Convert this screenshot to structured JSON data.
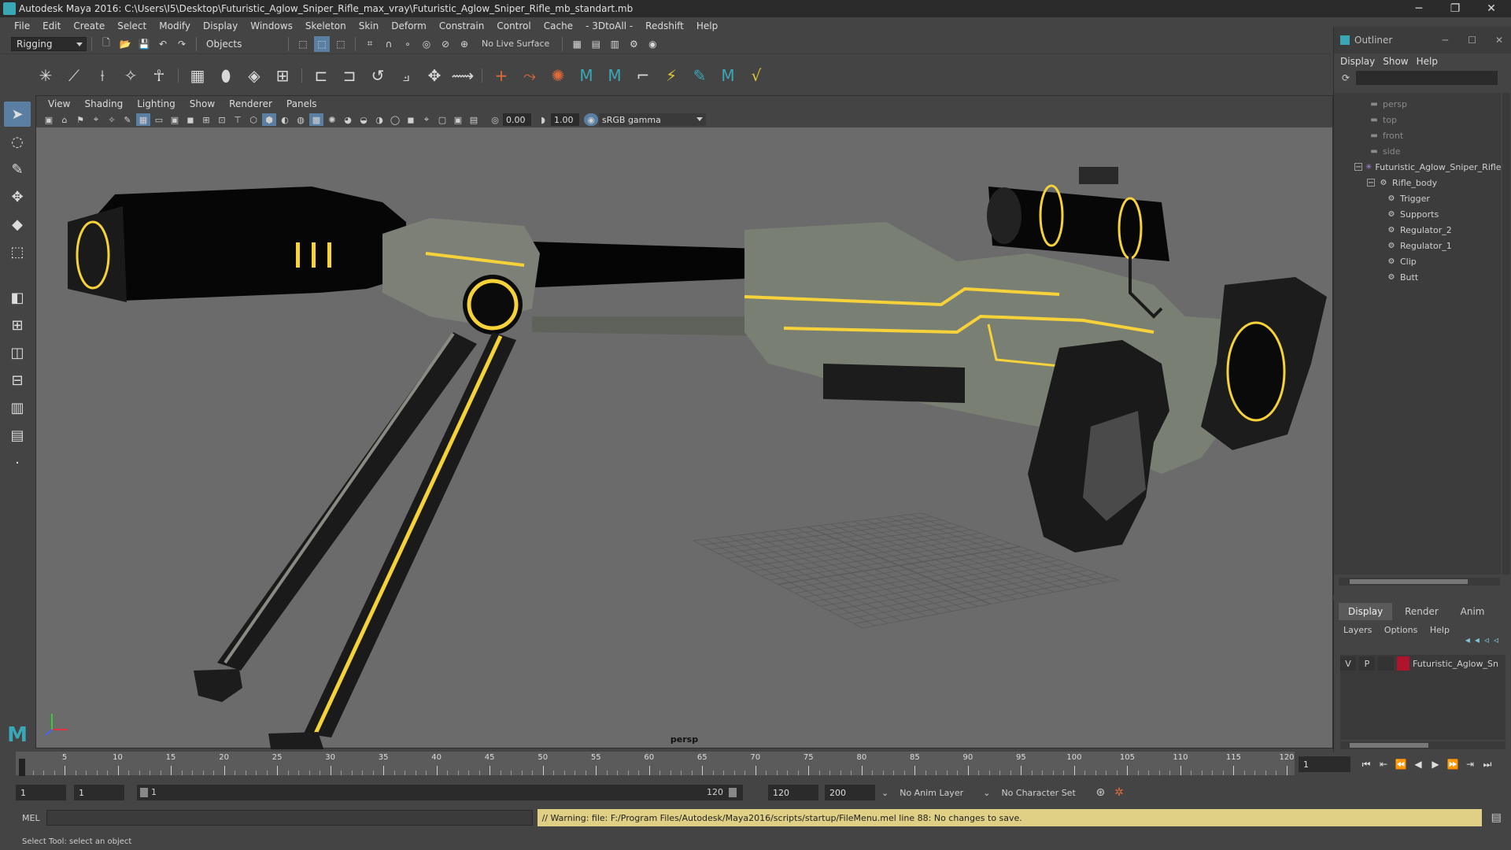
{
  "window": {
    "title": "Autodesk Maya 2016: C:\\Users\\I5\\Desktop\\Futuristic_Aglow_Sniper_Rifle_max_vray\\Futuristic_Aglow_Sniper_Rifle_mb_standart.mb",
    "minimize": "─",
    "maximize": "❐",
    "close": "✕"
  },
  "menubar": [
    "File",
    "Edit",
    "Create",
    "Select",
    "Modify",
    "Display",
    "Windows",
    "Skeleton",
    "Skin",
    "Deform",
    "Constrain",
    "Control",
    "Cache",
    "- 3DtoAll -",
    "Redshift",
    "Help"
  ],
  "statusline": {
    "menuset": "Rigging",
    "selection_mode": "Objects",
    "live_surface": "No Live Surface"
  },
  "viewport": {
    "menu": [
      "View",
      "Shading",
      "Lighting",
      "Show",
      "Renderer",
      "Panels"
    ],
    "exposure": "0.00",
    "gamma": "1.00",
    "color_space": "sRGB gamma",
    "camera": "persp"
  },
  "outliner": {
    "title": "Outliner",
    "menu": [
      "Display",
      "Show",
      "Help"
    ],
    "items": [
      {
        "label": "persp",
        "depth": 0,
        "dim": true,
        "icon": "camera-icon"
      },
      {
        "label": "top",
        "depth": 0,
        "dim": true,
        "icon": "camera-icon"
      },
      {
        "label": "front",
        "depth": 0,
        "dim": true,
        "icon": "camera-icon"
      },
      {
        "label": "side",
        "depth": 0,
        "dim": true,
        "icon": "camera-icon"
      },
      {
        "label": "Futuristic_Aglow_Sniper_Rifle",
        "depth": 0,
        "dim": false,
        "icon": "joint-star-icon",
        "expand": "−"
      },
      {
        "label": "Rifle_body",
        "depth": 1,
        "dim": false,
        "icon": "mesh-icon",
        "expand": "−"
      },
      {
        "label": "Trigger",
        "depth": 2,
        "dim": false,
        "icon": "mesh-icon"
      },
      {
        "label": "Supports",
        "depth": 2,
        "dim": false,
        "icon": "mesh-icon"
      },
      {
        "label": "Regulator_2",
        "depth": 2,
        "dim": false,
        "icon": "mesh-icon"
      },
      {
        "label": "Regulator_1",
        "depth": 2,
        "dim": false,
        "icon": "mesh-icon"
      },
      {
        "label": "Clip",
        "depth": 2,
        "dim": false,
        "icon": "mesh-icon"
      },
      {
        "label": "Butt",
        "depth": 2,
        "dim": false,
        "icon": "mesh-icon"
      }
    ]
  },
  "layers": {
    "tabs": [
      "Display",
      "Render",
      "Anim"
    ],
    "active_tab": "Display",
    "menu": [
      "Layers",
      "Options",
      "Help"
    ],
    "rows": [
      {
        "v": "V",
        "p": "P",
        "color": "#b0142a",
        "name": "Futuristic_Aglow_Sniper_Rifle"
      }
    ]
  },
  "timeslider": {
    "labels": [
      "1",
      "5",
      "10",
      "15",
      "20",
      "25",
      "30",
      "35",
      "40",
      "45",
      "50",
      "55",
      "60",
      "65",
      "70",
      "75",
      "80",
      "85",
      "90",
      "95",
      "100",
      "105",
      "110",
      "115",
      "120"
    ],
    "current_frame": "1"
  },
  "range": {
    "start": "1",
    "playback_start": "1",
    "slider_start": "1",
    "slider_end": "120",
    "playback_end": "120",
    "end": "200",
    "anim_layer": "No Anim Layer",
    "character_set": "No Character Set"
  },
  "commandline": {
    "language": "MEL",
    "warning": "// Warning: file: F:/Program Files/Autodesk/Maya2016/scripts/startup/FileMenu.mel line 88: No changes to save."
  },
  "helpline": "Select Tool: select an object",
  "colors": {
    "accent_yellow": "#f5d23a",
    "selection_blue": "#5a7fa3",
    "warning_bg": "#dfd085",
    "viewport_bg": "#6b6b6b"
  }
}
